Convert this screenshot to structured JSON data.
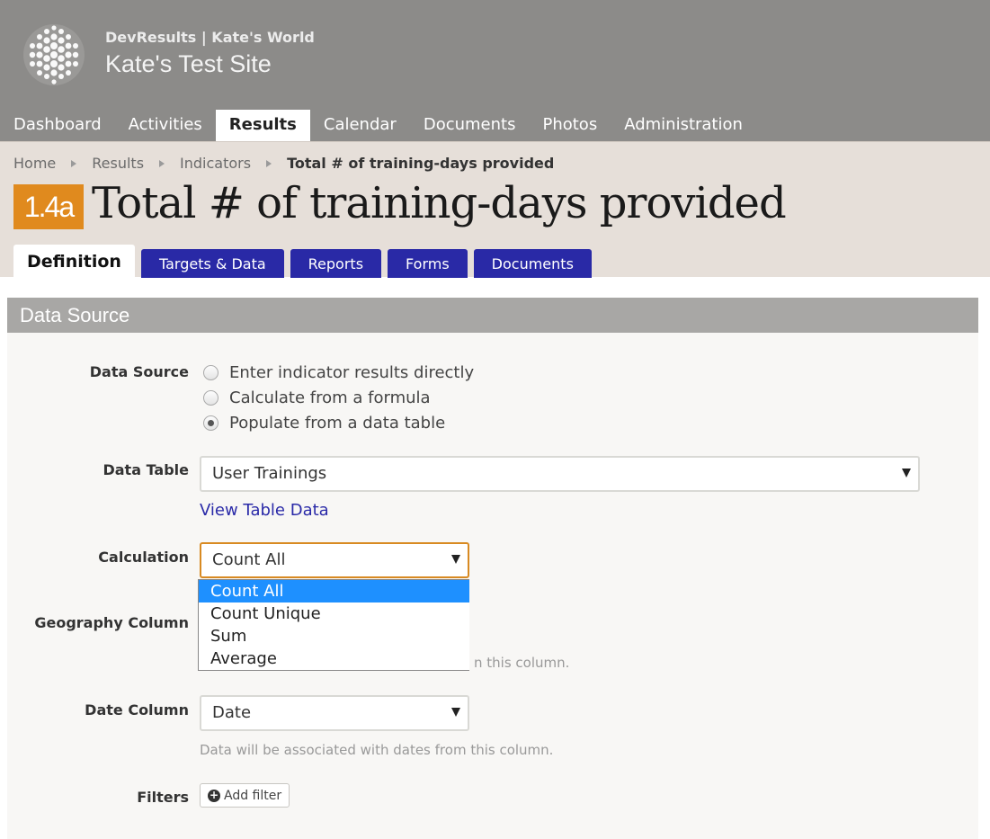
{
  "header": {
    "org": "DevResults | Kate's World",
    "site": "Kate's Test Site"
  },
  "nav": [
    "Dashboard",
    "Activities",
    "Results",
    "Calendar",
    "Documents",
    "Photos",
    "Administration"
  ],
  "nav_active": "Results",
  "breadcrumb": [
    "Home",
    "Results",
    "Indicators"
  ],
  "breadcrumb_current": "Total # of training-days provided",
  "indicator": {
    "code": "1.4a",
    "title": "Total # of training-days provided"
  },
  "tabs": [
    "Definition",
    "Targets & Data",
    "Reports",
    "Forms",
    "Documents"
  ],
  "tabs_active": "Definition",
  "colors": {
    "accent": "#e08a1e",
    "tab_blue": "#2929a6",
    "link": "#2a2aa8",
    "highlight": "#1e90ff"
  },
  "panel": {
    "title": "Data Source",
    "data_source_label": "Data Source",
    "radio_options": [
      "Enter indicator results directly",
      "Calculate from a formula",
      "Populate from a data table"
    ],
    "radio_selected": "Populate from a data table",
    "data_table_label": "Data Table",
    "data_table_value": "User Trainings",
    "view_table_link": "View Table Data",
    "calculation_label": "Calculation",
    "calculation_value": "Count All",
    "calculation_options": [
      "Count All",
      "Count Unique",
      "Sum",
      "Average"
    ],
    "geography_label": "Geography Column",
    "geography_hint_partial": "n this column.",
    "date_label": "Date Column",
    "date_value": "Date",
    "date_hint": "Data will be associated with dates from this column.",
    "filters_label": "Filters",
    "add_filter": "Add filter"
  }
}
